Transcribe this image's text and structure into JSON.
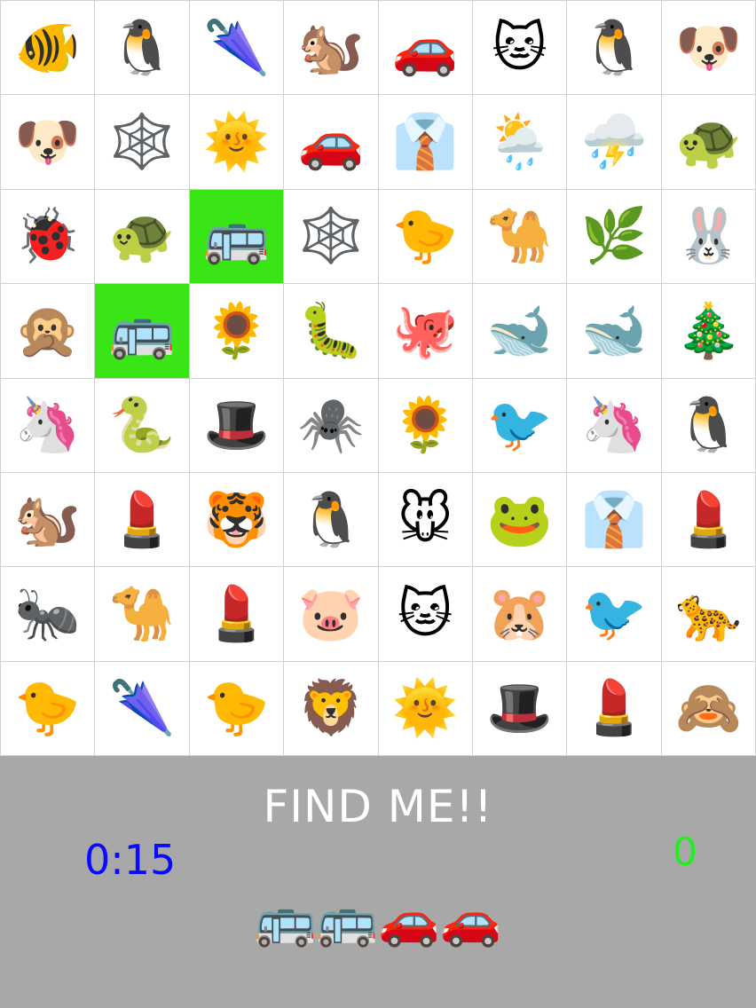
{
  "grid": [
    [
      {
        "emoji": "🐠",
        "name": "tropical-fish-icon"
      },
      {
        "emoji": "🐧",
        "name": "penguin-icon"
      },
      {
        "emoji": "🌂",
        "name": "closed-umbrella-icon"
      },
      {
        "emoji": "🐿️",
        "name": "chipmunk-icon"
      },
      {
        "emoji": "🚗",
        "name": "car-icon"
      },
      {
        "emoji": "🐱",
        "name": "cat-face-icon"
      },
      {
        "emoji": "🐧",
        "name": "penguin-icon"
      },
      {
        "emoji": "🐶",
        "name": "dog-face-icon"
      }
    ],
    [
      {
        "emoji": "🐶",
        "name": "dog-face-icon"
      },
      {
        "emoji": "🕸️",
        "name": "spider-web-icon"
      },
      {
        "emoji": "🌞",
        "name": "sun-with-face-icon"
      },
      {
        "emoji": "🚗",
        "name": "car-icon"
      },
      {
        "emoji": "👔",
        "name": "necktie-shirt-icon"
      },
      {
        "emoji": "🌦️",
        "name": "sun-rain-cloud-icon"
      },
      {
        "emoji": "⛈️",
        "name": "thunder-cloud-icon"
      },
      {
        "emoji": "🐢",
        "name": "turtle-icon"
      }
    ],
    [
      {
        "emoji": "🐞",
        "name": "ladybug-icon"
      },
      {
        "emoji": "🐢",
        "name": "turtle-icon"
      },
      {
        "emoji": "🚌",
        "name": "bus-icon",
        "highlight": true
      },
      {
        "emoji": "🕸️",
        "name": "spider-web-icon"
      },
      {
        "emoji": "🐤",
        "name": "chick-icon"
      },
      {
        "emoji": "🐪",
        "name": "camel-icon"
      },
      {
        "emoji": "🌿",
        "name": "herb-icon"
      },
      {
        "emoji": "🐰",
        "name": "rabbit-face-icon"
      }
    ],
    [
      {
        "emoji": "🙊",
        "name": "speak-no-evil-monkey-icon"
      },
      {
        "emoji": "🚌",
        "name": "bus-icon",
        "highlight": true
      },
      {
        "emoji": "🌻",
        "name": "sunflower-icon"
      },
      {
        "emoji": "🐛",
        "name": "caterpillar-icon"
      },
      {
        "emoji": "🐙",
        "name": "octopus-icon"
      },
      {
        "emoji": "🐋",
        "name": "whale-icon"
      },
      {
        "emoji": "🐋",
        "name": "whale-icon"
      },
      {
        "emoji": "🎄",
        "name": "christmas-tree-icon"
      }
    ],
    [
      {
        "emoji": "🦄",
        "name": "unicorn-icon"
      },
      {
        "emoji": "🐍",
        "name": "snake-icon"
      },
      {
        "emoji": "🎩",
        "name": "top-hat-icon"
      },
      {
        "emoji": "🕷️",
        "name": "spider-icon"
      },
      {
        "emoji": "🌻",
        "name": "sunflower-icon"
      },
      {
        "emoji": "🐦",
        "name": "bird-icon"
      },
      {
        "emoji": "🦄",
        "name": "unicorn-icon"
      },
      {
        "emoji": "🐧",
        "name": "penguin-icon"
      }
    ],
    [
      {
        "emoji": "🐿️",
        "name": "chipmunk-icon"
      },
      {
        "emoji": "💄",
        "name": "lipstick-icon"
      },
      {
        "emoji": "🐯",
        "name": "tiger-face-icon"
      },
      {
        "emoji": "🐧",
        "name": "penguin-icon"
      },
      {
        "emoji": "🐭",
        "name": "mouse-face-icon"
      },
      {
        "emoji": "🐸",
        "name": "frog-face-icon"
      },
      {
        "emoji": "👔",
        "name": "necktie-shirt-icon"
      },
      {
        "emoji": "💄",
        "name": "lipstick-icon"
      }
    ],
    [
      {
        "emoji": "🐜",
        "name": "ant-icon"
      },
      {
        "emoji": "🐪",
        "name": "camel-icon"
      },
      {
        "emoji": "💄",
        "name": "lipstick-icon"
      },
      {
        "emoji": "🐷",
        "name": "pig-face-icon"
      },
      {
        "emoji": "🐱",
        "name": "cat-face-icon"
      },
      {
        "emoji": "🐹",
        "name": "hamster-face-icon"
      },
      {
        "emoji": "🐦",
        "name": "bird-icon"
      },
      {
        "emoji": "🐆",
        "name": "leopard-icon"
      }
    ],
    [
      {
        "emoji": "🐤",
        "name": "chick-icon"
      },
      {
        "emoji": "🌂",
        "name": "closed-umbrella-icon"
      },
      {
        "emoji": "🐤",
        "name": "chick-icon"
      },
      {
        "emoji": "🦁",
        "name": "lion-face-icon"
      },
      {
        "emoji": "🌞",
        "name": "sun-with-face-icon"
      },
      {
        "emoji": "🎩",
        "name": "top-hat-icon"
      },
      {
        "emoji": "💄",
        "name": "lipstick-icon"
      },
      {
        "emoji": "🙈",
        "name": "see-no-evil-monkey-icon"
      }
    ]
  ],
  "panel": {
    "title": "FIND ME!!",
    "timer": "0:15",
    "score": "0",
    "target": [
      {
        "emoji": "🚌",
        "name": "bus-icon"
      },
      {
        "emoji": "🚌",
        "name": "bus-icon"
      },
      {
        "emoji": "🚗",
        "name": "car-icon"
      },
      {
        "emoji": "🚗",
        "name": "car-icon"
      }
    ]
  },
  "colors": {
    "highlight": "#39e515",
    "panel_background": "#a8a8a8",
    "timer": "#0a0aff",
    "score": "#22ee22",
    "title": "#ffffff"
  }
}
